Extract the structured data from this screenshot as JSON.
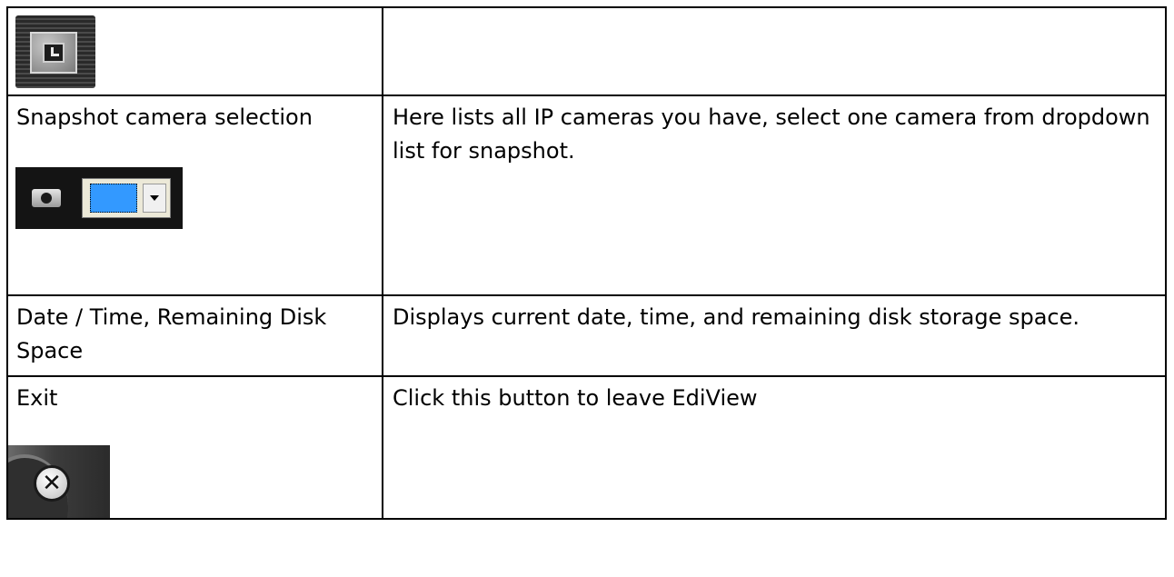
{
  "rows": [
    {
      "left_icon": "clock-icon",
      "right_text": ""
    },
    {
      "left_text": "Snapshot camera selection",
      "left_icon": "camera-dropdown-icon",
      "right_text": "Here lists all IP cameras you have, select one camera from dropdown list for snapshot.",
      "dropdown_swatch_color": "#3399ff"
    },
    {
      "left_text": "Date / Time, Remaining Disk Space",
      "right_text": "Displays current date, time, and remaining disk storage space."
    },
    {
      "left_text": "Exit",
      "left_icon": "exit-icon",
      "right_text": "Click this button to leave EdiView"
    }
  ]
}
